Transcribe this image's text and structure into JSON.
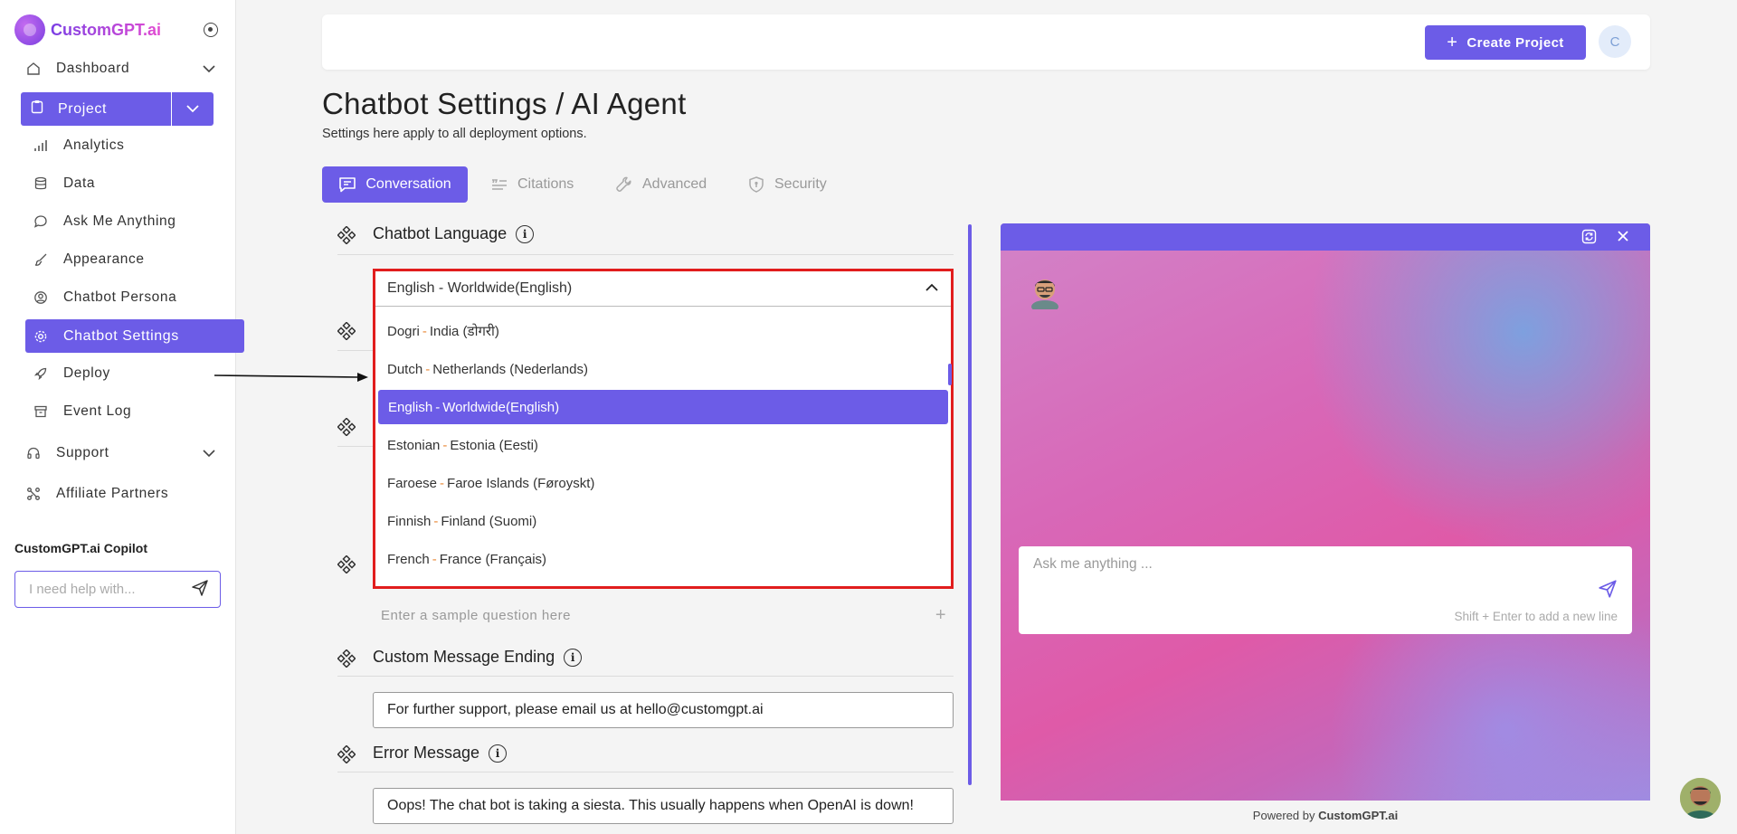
{
  "app": {
    "logo_text": "CustomGPT.ai"
  },
  "sidebar": {
    "dashboard": "Dashboard",
    "project": "Project",
    "items": [
      {
        "label": "Analytics",
        "icon": "bar-chart-icon"
      },
      {
        "label": "Data",
        "icon": "database-icon"
      },
      {
        "label": "Ask Me Anything",
        "icon": "chat-bubble-icon"
      },
      {
        "label": "Appearance",
        "icon": "brush-icon"
      },
      {
        "label": "Chatbot Persona",
        "icon": "persona-icon"
      },
      {
        "label": "Chatbot Settings",
        "icon": "gear-icon"
      },
      {
        "label": "Deploy",
        "icon": "rocket-icon"
      },
      {
        "label": "Event Log",
        "icon": "archive-icon"
      }
    ],
    "support": "Support",
    "affiliate": "Affiliate Partners",
    "copilot_title": "CustomGPT.ai Copilot",
    "copilot_placeholder": "I need help with..."
  },
  "header": {
    "create_project": "Create Project",
    "avatar_initial": "C"
  },
  "page": {
    "title": "Chatbot Settings / AI Agent",
    "subtitle": "Settings here apply to all deployment options."
  },
  "tabs": [
    {
      "label": "Conversation",
      "active": true
    },
    {
      "label": "Citations",
      "active": false
    },
    {
      "label": "Advanced",
      "active": false
    },
    {
      "label": "Security",
      "active": false
    }
  ],
  "form": {
    "chatbot_language_label": "Chatbot Language",
    "sample_question_placeholder": "Enter a sample question here",
    "custom_message_ending_label": "Custom Message Ending",
    "custom_message_ending_value": "For further support, please email us at hello@customgpt.ai",
    "error_message_label": "Error Message",
    "error_message_value": "Oops! The chat bot is taking a siesta. This usually happens when OpenAI is down!"
  },
  "dropdown": {
    "selected": "English - Worldwide(English)",
    "options": [
      {
        "lang": "Dogri",
        "region": "India (डोगरी)",
        "selected": false
      },
      {
        "lang": "Dutch",
        "region": "Netherlands (Nederlands)",
        "selected": false
      },
      {
        "lang": "English",
        "region": "Worldwide(English)",
        "selected": true
      },
      {
        "lang": "Estonian",
        "region": "Estonia (Eesti)",
        "selected": false
      },
      {
        "lang": "Faroese",
        "region": "Faroe Islands (Føroyskt)",
        "selected": false
      },
      {
        "lang": "Finnish",
        "region": "Finland (Suomi)",
        "selected": false
      },
      {
        "lang": "French",
        "region": "France (Français)",
        "selected": false
      }
    ]
  },
  "preview": {
    "input_placeholder": "Ask me anything ...",
    "hint": "Shift + Enter to add a new line",
    "powered_prefix": "Powered by",
    "powered_brand": "CustomGPT.ai"
  },
  "colors": {
    "accent": "#6c5ce7",
    "highlight_border": "#e11d1d"
  }
}
